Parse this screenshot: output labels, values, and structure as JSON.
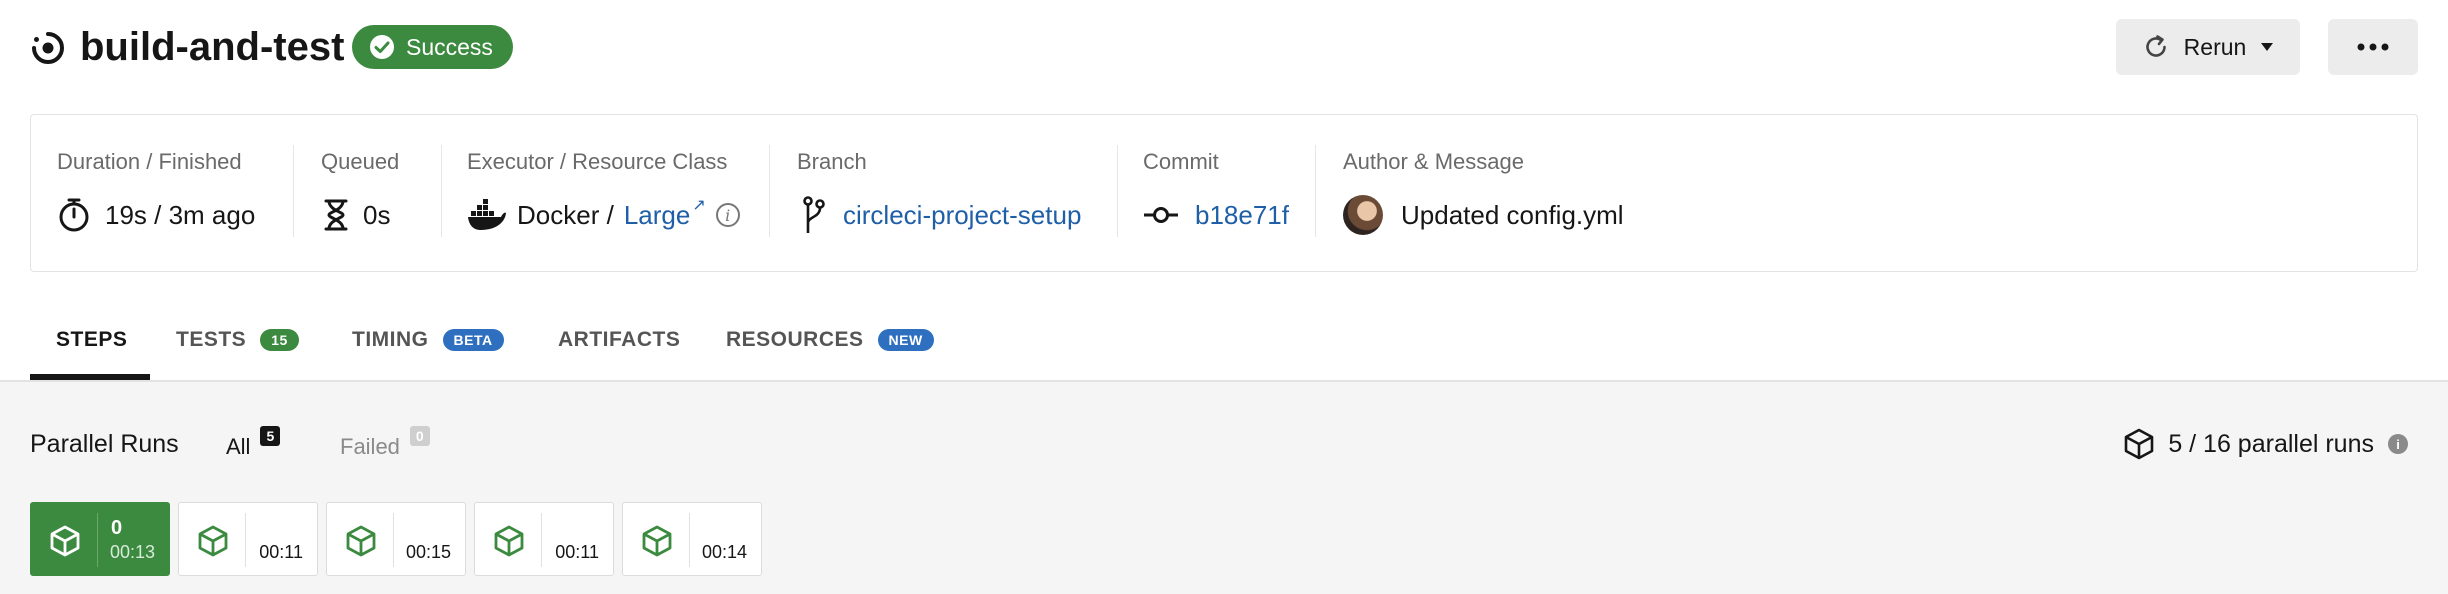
{
  "header": {
    "job_title": "build-and-test",
    "status": "Success",
    "rerun_label": "Rerun"
  },
  "details": {
    "duration": {
      "label": "Duration / Finished",
      "value": "19s / 3m ago"
    },
    "queued": {
      "label": "Queued",
      "value": "0s"
    },
    "executor": {
      "label": "Executor / Resource Class",
      "executor": "Docker /",
      "resource_class": "Large"
    },
    "branch": {
      "label": "Branch",
      "value": "circleci-project-setup"
    },
    "commit": {
      "label": "Commit",
      "value": "b18e71f"
    },
    "author": {
      "label": "Author & Message",
      "message": "Updated config.yml"
    }
  },
  "tabs": [
    {
      "label": "STEPS",
      "active": true
    },
    {
      "label": "TESTS",
      "badge": "15"
    },
    {
      "label": "TIMING",
      "badge": "BETA"
    },
    {
      "label": "ARTIFACTS"
    },
    {
      "label": "RESOURCES",
      "badge": "NEW"
    }
  ],
  "parallel": {
    "title": "Parallel Runs",
    "filter_all": "All",
    "filter_all_count": "5",
    "filter_failed": "Failed",
    "filter_failed_count": "0",
    "summary": "5 / 16 parallel runs",
    "runs": [
      {
        "index": "0",
        "time": "00:13",
        "active": true
      },
      {
        "time": "00:11"
      },
      {
        "time": "00:15"
      },
      {
        "time": "00:11"
      },
      {
        "time": "00:14"
      }
    ]
  },
  "colors": {
    "success": "#3b8a3f",
    "link": "#1f5fa8",
    "badge_blue": "#2f6fbf"
  },
  "icons": {
    "job": "job-status-icon",
    "success": "check-circle-icon",
    "rerun": "refresh-icon",
    "more": "ellipsis-icon",
    "duration": "stopwatch-icon",
    "queued": "hourglass-icon",
    "executor": "docker-icon",
    "branch": "git-branch-icon",
    "commit": "git-commit-icon",
    "run": "cube-icon"
  }
}
